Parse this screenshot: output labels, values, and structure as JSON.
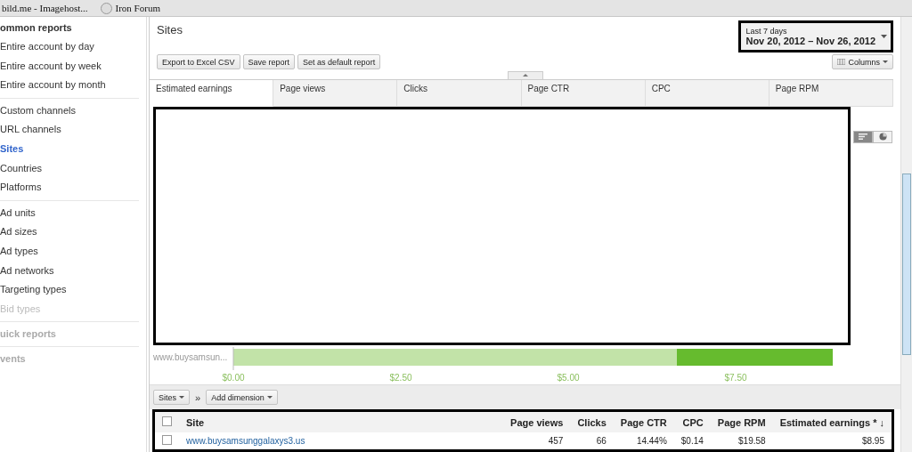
{
  "browser_tabs": [
    "bild.me - Imagehost...",
    "Iron Forum"
  ],
  "sidebar": {
    "sections": [
      {
        "title": "ommon reports",
        "disabled": false,
        "groups": [
          [
            {
              "label": "Entire account by day",
              "selected": false,
              "disabled": false
            },
            {
              "label": "Entire account by week",
              "selected": false,
              "disabled": false
            },
            {
              "label": "Entire account by month",
              "selected": false,
              "disabled": false
            }
          ],
          [
            {
              "label": "Custom channels",
              "selected": false,
              "disabled": false
            },
            {
              "label": "URL channels",
              "selected": false,
              "disabled": false
            },
            {
              "label": "Sites",
              "selected": true,
              "disabled": false
            },
            {
              "label": "Countries",
              "selected": false,
              "disabled": false
            },
            {
              "label": "Platforms",
              "selected": false,
              "disabled": false
            }
          ],
          [
            {
              "label": "Ad units",
              "selected": false,
              "disabled": false
            },
            {
              "label": "Ad sizes",
              "selected": false,
              "disabled": false
            },
            {
              "label": "Ad types",
              "selected": false,
              "disabled": false
            },
            {
              "label": "Ad networks",
              "selected": false,
              "disabled": false
            },
            {
              "label": "Targeting types",
              "selected": false,
              "disabled": false
            },
            {
              "label": "Bid types",
              "selected": false,
              "disabled": true
            }
          ]
        ]
      },
      {
        "title": "uick reports",
        "disabled": true
      },
      {
        "title": "vents",
        "disabled": true
      }
    ]
  },
  "report": {
    "title": "Sites",
    "date_range": {
      "caption": "Last 7 days",
      "range": "Nov 20, 2012 – Nov 26, 2012"
    },
    "actions": [
      "Export to Excel CSV",
      "Save report",
      "Set as default report"
    ],
    "columns_button": "Columns",
    "metric_tabs": [
      {
        "label": "Estimated earnings",
        "selected": true
      },
      {
        "label": "Page views",
        "selected": false
      },
      {
        "label": "Clicks",
        "selected": false
      },
      {
        "label": "Page CTR",
        "selected": false
      },
      {
        "label": "CPC",
        "selected": false
      },
      {
        "label": "Page RPM",
        "selected": false
      }
    ],
    "chart_types": [
      {
        "kind": "bar",
        "selected": true
      },
      {
        "kind": "pie",
        "selected": false
      }
    ],
    "chart": {
      "chart_data": {
        "type": "bar",
        "orientation": "horizontal",
        "categories": [
          "www.buysamsun..."
        ],
        "values": [
          8.95
        ],
        "xlim": [
          0,
          9.9
        ],
        "xticks": [
          {
            "value": 0,
            "label": "$0.00"
          },
          {
            "value": 2.5,
            "label": "$2.50"
          },
          {
            "value": 5,
            "label": "$5.00"
          },
          {
            "value": 7.5,
            "label": "$7.50"
          }
        ]
      }
    },
    "dimension_bar": {
      "dimension": "Sites",
      "separator": "»",
      "add": "Add dimension"
    },
    "table": {
      "columns": [
        "Site",
        "Page views",
        "Clicks",
        "Page CTR",
        "CPC",
        "Page RPM",
        "Estimated earnings * ↓"
      ],
      "header_checked": false,
      "rows": [
        {
          "checked": false,
          "cells": [
            "www.buysamsunggalaxys3.us",
            "457",
            "66",
            "14.44%",
            "$0.14",
            "$19.58",
            "$8.95"
          ]
        }
      ]
    }
  }
}
